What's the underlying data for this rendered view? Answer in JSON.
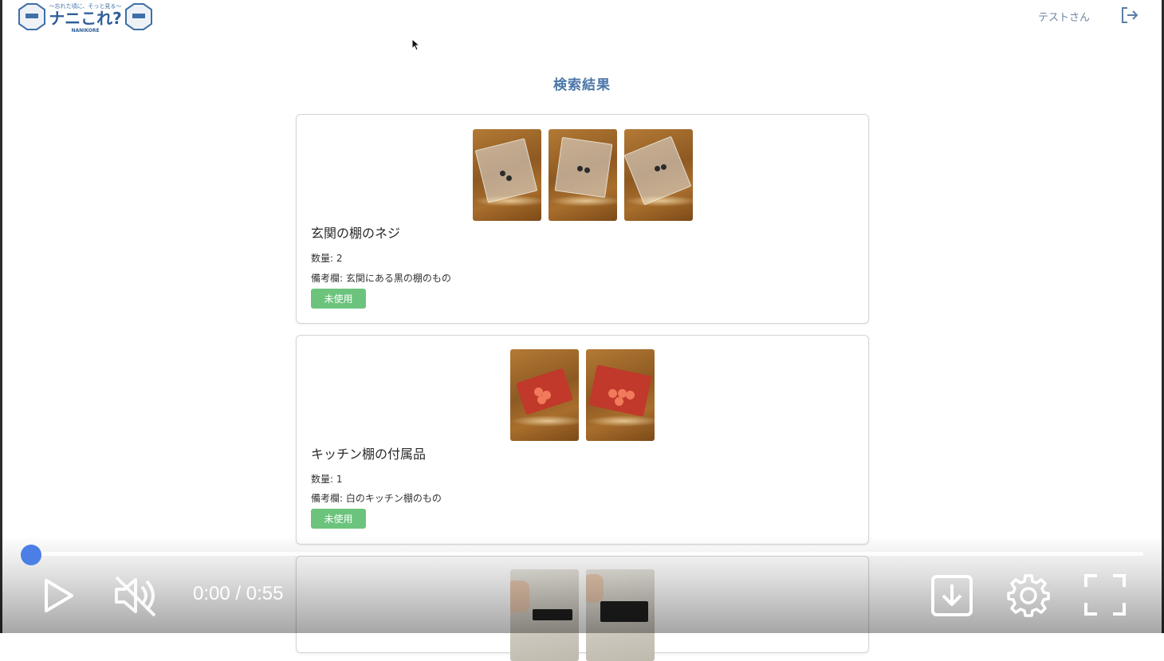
{
  "header": {
    "logo_text": "ナニこれ?",
    "logo_tagline": "〜忘れた頃に、そっと見る〜",
    "logo_sub": "NANIKORE",
    "user_label": "テストさん",
    "logout_icon": "logout-icon"
  },
  "page": {
    "title": "検索結果"
  },
  "items": [
    {
      "name": "玄関の棚のネジ",
      "quantity": "数量: 2",
      "note": "備考欄: 玄関にある黒の棚のもの",
      "status": "未使用",
      "photos": 3
    },
    {
      "name": "キッチン棚の付属品",
      "quantity": "数量: 1",
      "note": "備考欄: 白のキッチン棚のもの",
      "status": "未使用",
      "photos": 2
    },
    {
      "photos": 2
    }
  ],
  "player": {
    "time": "0:00 / 0:55",
    "progress": 0,
    "play_icon": "play-icon",
    "mute_icon": "muted-speaker-icon",
    "download_icon": "download-icon",
    "settings_icon": "gear-icon",
    "fullscreen_icon": "fullscreen-icon",
    "accent_color": "#4b7fe6"
  },
  "colors": {
    "title": "#4a76a8",
    "status_badge": "#6cc47c"
  }
}
